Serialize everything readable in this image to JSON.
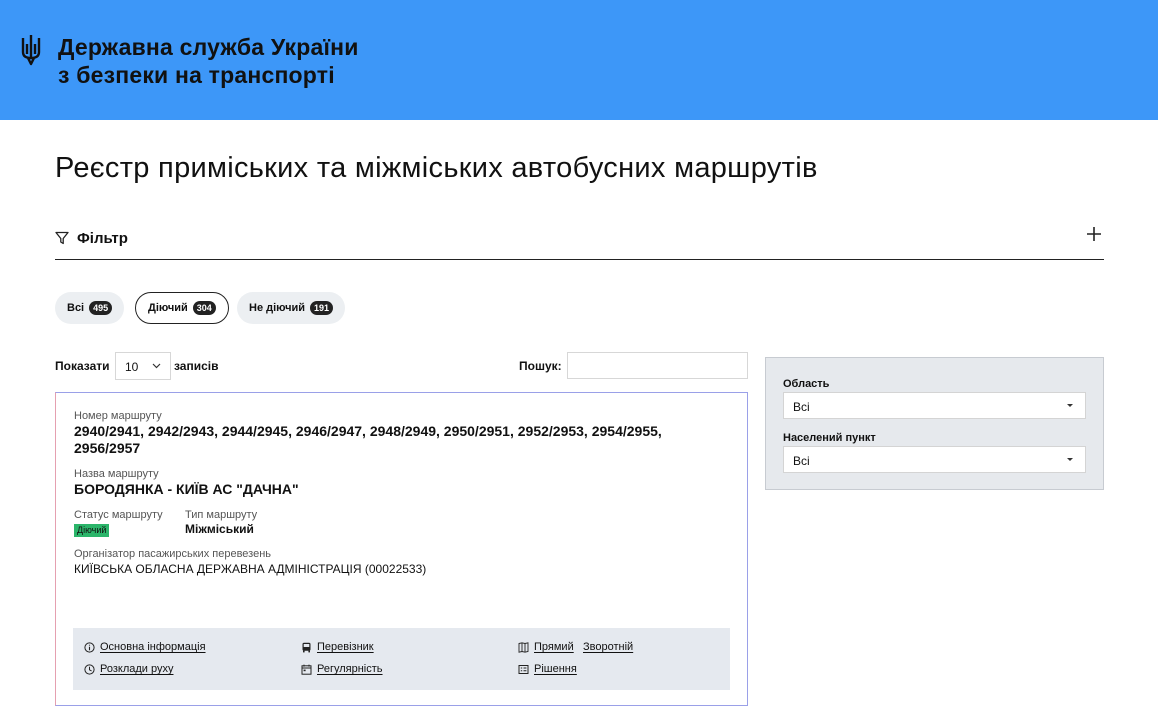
{
  "header": {
    "org_line1": "Державна служба України",
    "org_line2": "з безпеки на транспорті",
    "logo_icon": "trident-icon"
  },
  "page_title": "Реєстр приміських та міжміських автобусних маршрутів",
  "filter": {
    "label": "Фільтр",
    "expand_icon": "plus-icon"
  },
  "chips": [
    {
      "label": "Всі",
      "count": "495",
      "active": false
    },
    {
      "label": "Діючий",
      "count": "304",
      "active": true
    },
    {
      "label": "Не діючий",
      "count": "191",
      "active": false
    }
  ],
  "table_controls": {
    "show_label": "Показати",
    "page_size": "10",
    "records_label": "записів",
    "search_label": "Пошук:",
    "search_value": ""
  },
  "route_card": {
    "number_label": "Номер маршруту",
    "number_value": "2940/2941, 2942/2943, 2944/2945, 2946/2947, 2948/2949, 2950/2951, 2952/2953, 2954/2955, 2956/2957",
    "name_label": "Назва маршруту",
    "name_value": "БОРОДЯНКА - КИЇВ АС \"ДАЧНА\"",
    "status_label": "Статус маршруту",
    "status_value": "Діючий",
    "status_color": "#2bb56a",
    "type_label": "Тип маршруту",
    "type_value": "Міжміський",
    "organizer_label": "Організатор пасажирських перевезень",
    "organizer_value": "КИЇВСЬКА ОБЛАСНА ДЕРЖАВНА АДМІНІСТРАЦІЯ (00022533)",
    "actions": {
      "main_info": "Основна інформація",
      "carrier": "Перевізник",
      "direct": "Прямий",
      "reverse": "Зворотній",
      "schedule": "Розклади руху",
      "regularity": "Регулярність",
      "decision": "Рішення"
    }
  },
  "side_filters": {
    "region_label": "Область",
    "region_value": "Всі",
    "settlement_label": "Населений пункт",
    "settlement_value": "Всі"
  },
  "colors": {
    "header_bg": "#3d97f8",
    "panel_bg": "#e6e9ed",
    "actions_bg": "#e5e9ef"
  }
}
